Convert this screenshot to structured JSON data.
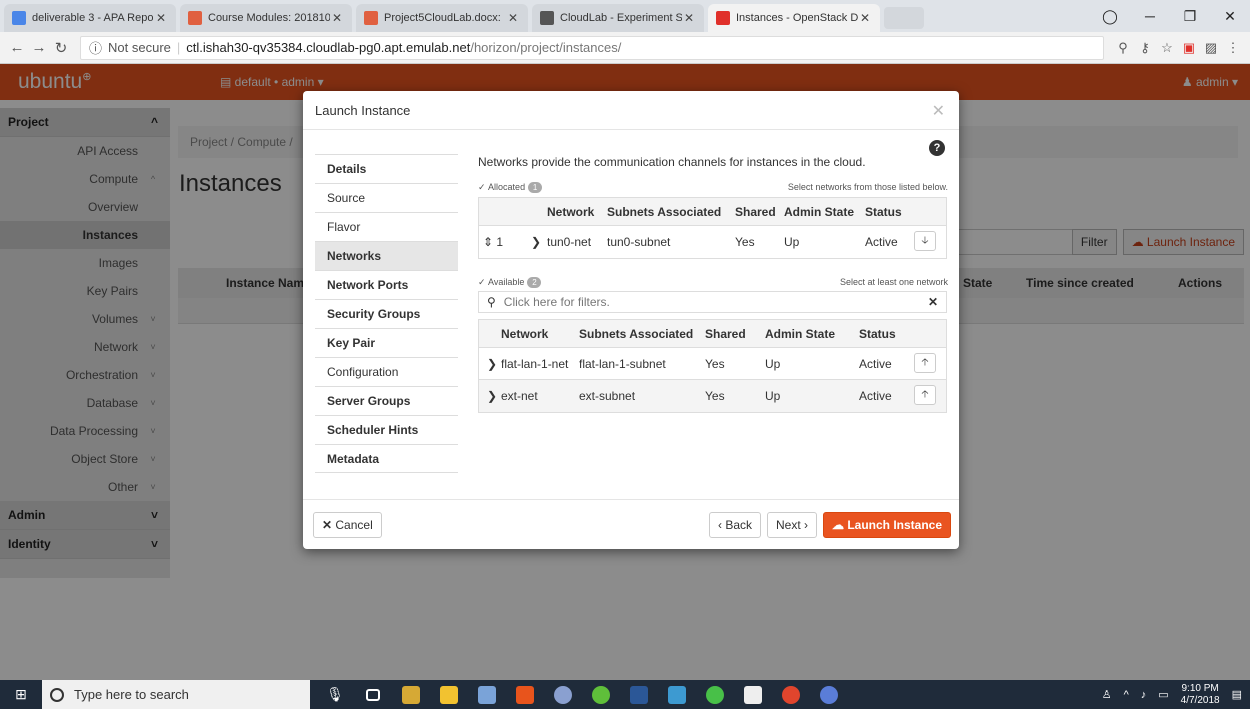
{
  "browser": {
    "tabs": [
      {
        "title": "deliverable 3 - APA Repo",
        "color": "#4a86e8"
      },
      {
        "title": "Course Modules: 201810",
        "color": "#e06040"
      },
      {
        "title": "Project5CloudLab.docx:",
        "color": "#e06040"
      },
      {
        "title": "CloudLab - Experiment S",
        "color": "#555555"
      },
      {
        "title": "Instances - OpenStack D",
        "color": "#e0302a"
      }
    ],
    "url_security": "Not secure",
    "url_host": "ctl.ishah30-qv35384.cloudlab-pg0.apt.emulab.net",
    "url_path": "/horizon/project/instances/"
  },
  "header": {
    "brand": "ubuntu",
    "project_selector": "default • admin ▾",
    "user_menu": "admin ▾"
  },
  "sidebar": {
    "sections": [
      {
        "label": "Project",
        "chev": "^"
      },
      {
        "label": "Admin",
        "chev": "˅"
      },
      {
        "label": "Identity",
        "chev": "˅"
      }
    ],
    "items": [
      {
        "label": "API Access",
        "chev": ""
      },
      {
        "label": "Compute",
        "chev": "^"
      },
      {
        "label": "Overview",
        "chev": ""
      },
      {
        "label": "Instances",
        "chev": ""
      },
      {
        "label": "Images",
        "chev": ""
      },
      {
        "label": "Key Pairs",
        "chev": ""
      },
      {
        "label": "Volumes",
        "chev": "˅"
      },
      {
        "label": "Network",
        "chev": "˅"
      },
      {
        "label": "Orchestration",
        "chev": "˅"
      },
      {
        "label": "Database",
        "chev": "˅"
      },
      {
        "label": "Data Processing",
        "chev": "˅"
      },
      {
        "label": "Object Store",
        "chev": "˅"
      },
      {
        "label": "Other",
        "chev": "˅"
      }
    ]
  },
  "page": {
    "breadcrumb": "Project / Compute /",
    "title": "Instances",
    "filter_label": "Filter",
    "launch_label": "Launch Instance",
    "columns": [
      "Instance Name",
      "State",
      "Time since created",
      "Actions"
    ]
  },
  "modal": {
    "title": "Launch Instance",
    "nav": [
      "Details",
      "Source",
      "Flavor",
      "Networks",
      "Network Ports",
      "Security Groups",
      "Key Pair",
      "Configuration",
      "Server Groups",
      "Scheduler Hints",
      "Metadata"
    ],
    "description": "Networks provide the communication channels for instances in the cloud.",
    "allocated": {
      "label": "Allocated",
      "count": "1",
      "hint": "Select networks from those listed below.",
      "columns": [
        "Network",
        "Subnets Associated",
        "Shared",
        "Admin State",
        "Status"
      ],
      "rows": [
        {
          "order": "1",
          "network": "tun0-net",
          "subnets": "tun0-subnet",
          "shared": "Yes",
          "admin_state": "Up",
          "status": "Active"
        }
      ]
    },
    "available": {
      "label": "Available",
      "count": "2",
      "hint": "Select at least one network",
      "search_placeholder": "Click here for filters.",
      "columns": [
        "Network",
        "Subnets Associated",
        "Shared",
        "Admin State",
        "Status"
      ],
      "rows": [
        {
          "network": "flat-lan-1-net",
          "subnets": "flat-lan-1-subnet",
          "shared": "Yes",
          "admin_state": "Up",
          "status": "Active"
        },
        {
          "network": "ext-net",
          "subnets": "ext-subnet",
          "shared": "Yes",
          "admin_state": "Up",
          "status": "Active"
        }
      ]
    },
    "buttons": {
      "cancel": "Cancel",
      "back": "‹ Back",
      "next": "Next ›",
      "launch": "Launch Instance"
    }
  },
  "taskbar": {
    "search_placeholder": "Type here to search",
    "time": "9:10 PM",
    "date": "4/7/2018"
  },
  "colors": {
    "brand_orange": "#e95420"
  }
}
